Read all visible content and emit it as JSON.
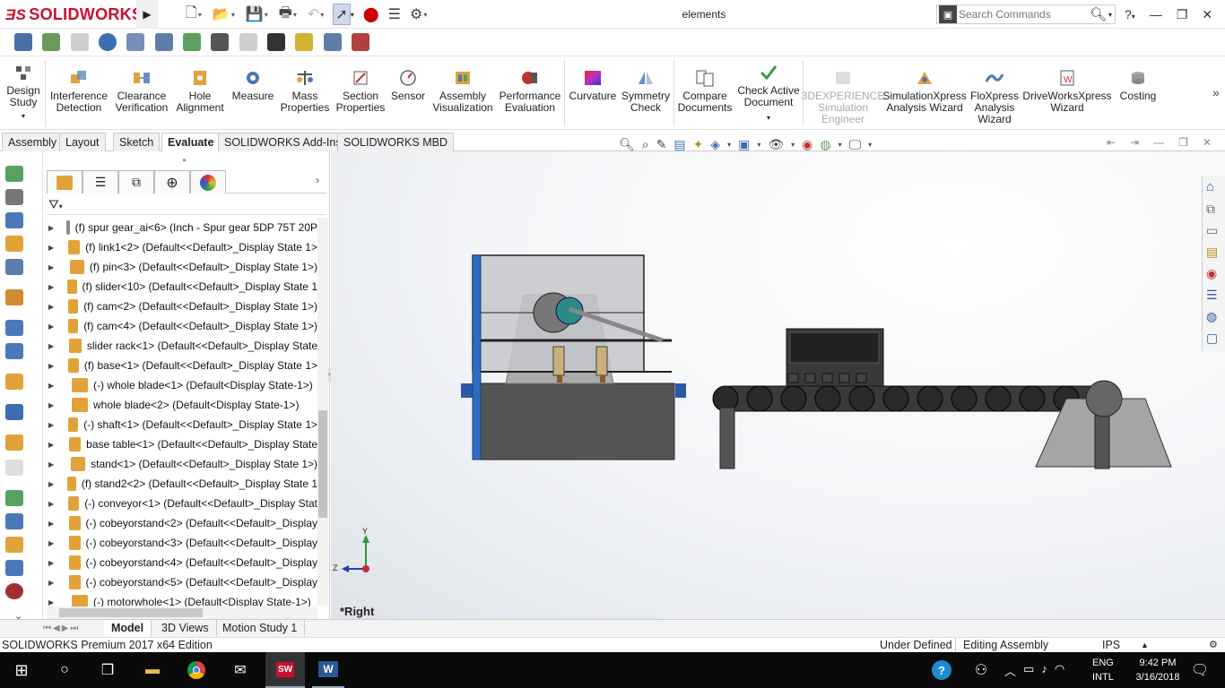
{
  "app": {
    "brand": "SOLIDWORKS",
    "document_title": "elements"
  },
  "search": {
    "placeholder": "Search Commands"
  },
  "commands": [
    {
      "line1": "Design",
      "line2": "Study",
      "icon": "design-study-icon"
    },
    {
      "line1": "Interference",
      "line2": "Detection",
      "icon": "interference-icon"
    },
    {
      "line1": "Clearance",
      "line2": "Verification",
      "icon": "clearance-icon"
    },
    {
      "line1": "Hole",
      "line2": "Alignment",
      "icon": "hole-alignment-icon"
    },
    {
      "line1": "Measure",
      "line2": "",
      "icon": "measure-icon"
    },
    {
      "line1": "Mass",
      "line2": "Properties",
      "icon": "mass-properties-icon"
    },
    {
      "line1": "Section",
      "line2": "Properties",
      "icon": "section-properties-icon"
    },
    {
      "line1": "Sensor",
      "line2": "",
      "icon": "sensor-icon"
    },
    {
      "line1": "Assembly",
      "line2": "Visualization",
      "icon": "assembly-visualization-icon"
    },
    {
      "line1": "Performance",
      "line2": "Evaluation",
      "icon": "performance-icon"
    },
    {
      "line1": "Curvature",
      "line2": "",
      "icon": "curvature-icon"
    },
    {
      "line1": "Symmetry",
      "line2": "Check",
      "icon": "symmetry-icon"
    },
    {
      "line1": "Compare",
      "line2": "Documents",
      "icon": "compare-icon"
    },
    {
      "line1": "Check Active",
      "line2": "Document",
      "icon": "check-active-icon"
    },
    {
      "line1": "3DEXPERIENCE",
      "line2": "Simulation",
      "line3": "Engineer",
      "icon": "3dexperience-icon"
    },
    {
      "line1": "SimulationXpress",
      "line2": "Analysis Wizard",
      "icon": "simulationxpress-icon"
    },
    {
      "line1": "FloXpress",
      "line2": "Analysis",
      "line3": "Wizard",
      "icon": "floxpress-icon"
    },
    {
      "line1": "DriveWorksXpress",
      "line2": "Wizard",
      "icon": "driveworks-icon"
    },
    {
      "line1": "Costing",
      "line2": "",
      "icon": "costing-icon"
    }
  ],
  "tabs": [
    "Assembly",
    "Layout",
    "Sketch",
    "Evaluate",
    "SOLIDWORKS Add-Ins",
    "SOLIDWORKS MBD"
  ],
  "active_tab": "Evaluate",
  "tree": [
    "(f) spur gear_ai<6> (Inch - Spur gear 5DP 75T 20P",
    "(f) link1<2> (Default<<Default>_Display State 1>",
    "(f) pin<3> (Default<<Default>_Display State 1>)",
    "(f) slider<10> (Default<<Default>_Display State 1",
    "(f) cam<2> (Default<<Default>_Display State 1>)",
    "(f) cam<4> (Default<<Default>_Display State 1>)",
    "slider rack<1> (Default<<Default>_Display State",
    "(f) base<1> (Default<<Default>_Display State 1>",
    "(-) whole blade<1> (Default<Display State-1>)",
    "whole blade<2> (Default<Display State-1>)",
    "(-) shaft<1> (Default<<Default>_Display State 1>",
    "base table<1> (Default<<Default>_Display State",
    "stand<1> (Default<<Default>_Display State 1>)",
    "(f) stand2<2> (Default<<Default>_Display State 1",
    "(-) conveyor<1> (Default<<Default>_Display Stat",
    "(-) cobeyorstand<2> (Default<<Default>_Display",
    "(-) cobeyorstand<3> (Default<<Default>_Display",
    "(-) cobeyorstand<4> (Default<<Default>_Display",
    "(-) cobeyorstand<5> (Default<<Default>_Display",
    "(-) motorwhole<1> (Default<Display State-1>)"
  ],
  "viewport": {
    "view_label": "*Right",
    "axis_y": "Y",
    "axis_z": "Z"
  },
  "bottom_tabs": [
    "Model",
    "3D Views",
    "Motion Study 1"
  ],
  "status": {
    "edition": "SOLIDWORKS Premium 2017 x64 Edition",
    "state": "Under Defined",
    "mode": "Editing Assembly",
    "units": "IPS"
  },
  "taskbar": {
    "lang1": "ENG",
    "lang2": "INTL",
    "time": "9:42 PM",
    "date": "3/16/2018"
  },
  "colors": {
    "brand": "#c8102e",
    "taskbar": "#0a0a0a",
    "accent_blue": "#1f5fb4"
  }
}
